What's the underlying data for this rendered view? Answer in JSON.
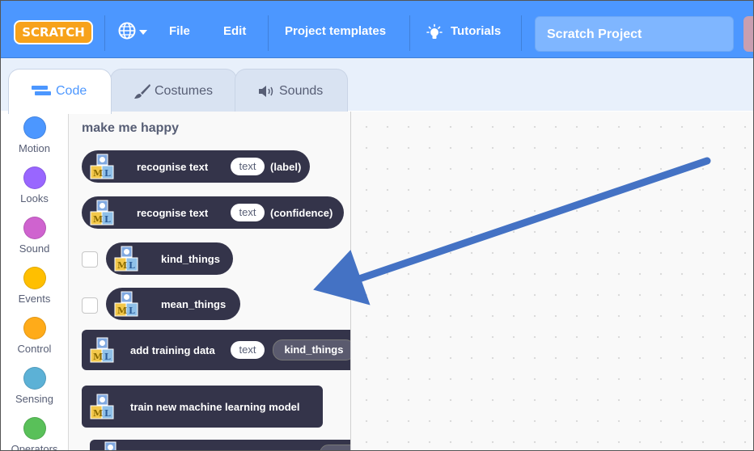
{
  "menubar": {
    "logo": "SCRATCH",
    "file": "File",
    "edit": "Edit",
    "project_templates": "Project templates",
    "tutorials": "Tutorials",
    "project_title": "Scratch Project"
  },
  "tabs": [
    {
      "label": "Code",
      "active": true
    },
    {
      "label": "Costumes",
      "active": false
    },
    {
      "label": "Sounds",
      "active": false
    }
  ],
  "categories": [
    {
      "label": "Motion",
      "color": "#4c97ff"
    },
    {
      "label": "Looks",
      "color": "#9966ff"
    },
    {
      "label": "Sound",
      "color": "#cf63cf"
    },
    {
      "label": "Events",
      "color": "#ffbf00"
    },
    {
      "label": "Control",
      "color": "#ffab19"
    },
    {
      "label": "Sensing",
      "color": "#5cb1d6"
    },
    {
      "label": "Operators",
      "color": "#59c059"
    }
  ],
  "palette": {
    "heading": "make me happy",
    "blocks": {
      "recognise_label": {
        "text": "recognise text",
        "input": "text",
        "suffix": "(label)"
      },
      "recognise_confidence": {
        "text": "recognise text",
        "input": "text",
        "suffix": "(confidence)"
      },
      "kind_things": {
        "text": "kind_things"
      },
      "mean_things": {
        "text": "mean_things"
      },
      "add_training": {
        "text": "add training data",
        "input": "text",
        "var": "kind_things"
      },
      "train_model": {
        "text": "train new machine learning model"
      }
    },
    "block_icon": "ml-extension-icon"
  },
  "colors": {
    "menubar": "#4c97ff",
    "block": "#34344a",
    "annotation_arrow": "#4472c4"
  }
}
